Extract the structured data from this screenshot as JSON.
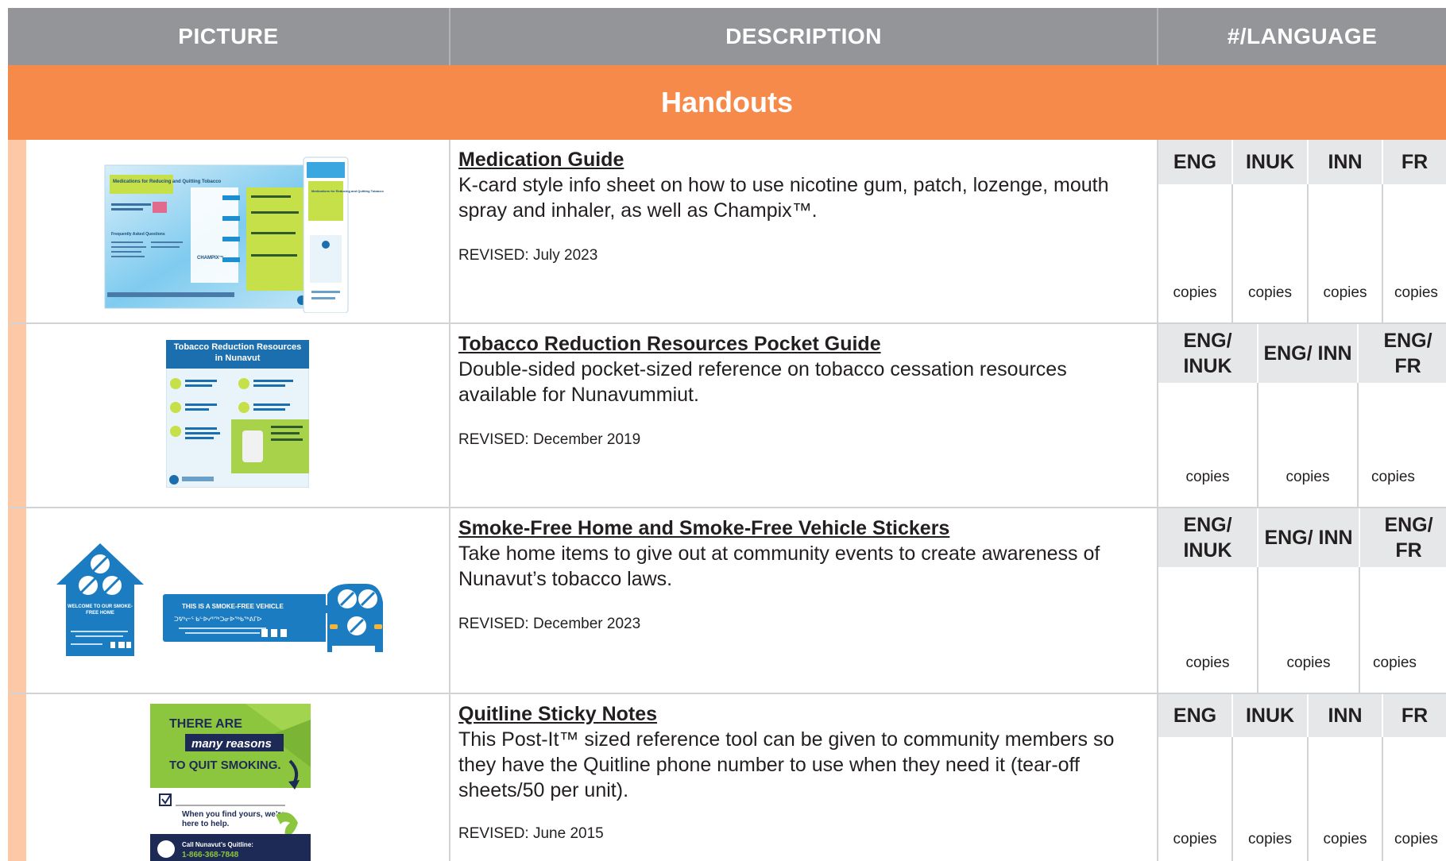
{
  "header": {
    "picture": "PICTURE",
    "description": "DESCRIPTION",
    "language": "#/LANGUAGE"
  },
  "section": {
    "title": "Handouts"
  },
  "copies_label": "copies",
  "rows": [
    {
      "title": "Medication Guide",
      "body": "K-card style info sheet on how to use nicotine gum, patch, lozenge, mouth spray and inhaler, as well as Champix™.",
      "revised": "REVISED: July 2023",
      "langs": [
        "ENG",
        "INUK",
        "INN",
        "FR"
      ],
      "thumb": {
        "main_title": "Medications for Reducing and Quitting Tobacco",
        "faq": "Frequently Asked Questions",
        "champix": "CHAMPIX™",
        "side": "Medications for Reducing and Quitting Tobacco"
      }
    },
    {
      "title": "Tobacco Reduction Resources Pocket Guide",
      "body": "Double-sided pocket-sized reference on tobacco cessation resources available for Nunavummiut.",
      "revised": "REVISED: December 2019",
      "langs": [
        "ENG/ INUK",
        "ENG/ INN",
        "ENG/ FR"
      ],
      "thumb": {
        "title": "Tobacco Reduction Resources in Nunavut"
      }
    },
    {
      "title": "Smoke-Free Home and Smoke-Free Vehicle Stickers",
      "body": "Take home items to give out at community events to create awareness of Nunavut’s tobacco laws.",
      "revised": "REVISED: December 2023",
      "langs": [
        "ENG/ INUK",
        "ENG/ INN",
        "ENG/ FR"
      ],
      "thumb": {
        "home_text": "WELCOME TO OUR SMOKE-FREE HOME",
        "vehicle_text": "THIS IS A SMOKE-FREE VEHICLE",
        "syllabics": "ᑐᕓᒃᓕᕐ ᑲᓪᐉᓯᐦᖅᑐᓂᐉᖅᑲᖅᕕᒥᐅ"
      }
    },
    {
      "title": "Quitline Sticky Notes",
      "body": "This Post-It™ sized reference tool can be given to community members so they have the Quitline phone number to use when they need it (tear-off sheets/50 per unit).",
      "revised": "REVISED: June 2015",
      "langs": [
        "ENG",
        "INUK",
        "INN",
        "FR"
      ],
      "thumb": {
        "line1": "THERE ARE",
        "line2": "many reasons",
        "line3": "TO QUIT SMOKING.",
        "find": "When you find yours, we’re here to help.",
        "call": "Call Nunavut’s Quitline:",
        "phone": "1-866-368-7848"
      }
    }
  ],
  "colors": {
    "header": "#939598",
    "section": "#f58a4b",
    "stripe": "#fcc8a5",
    "lang_header": "#e6e7e8"
  }
}
